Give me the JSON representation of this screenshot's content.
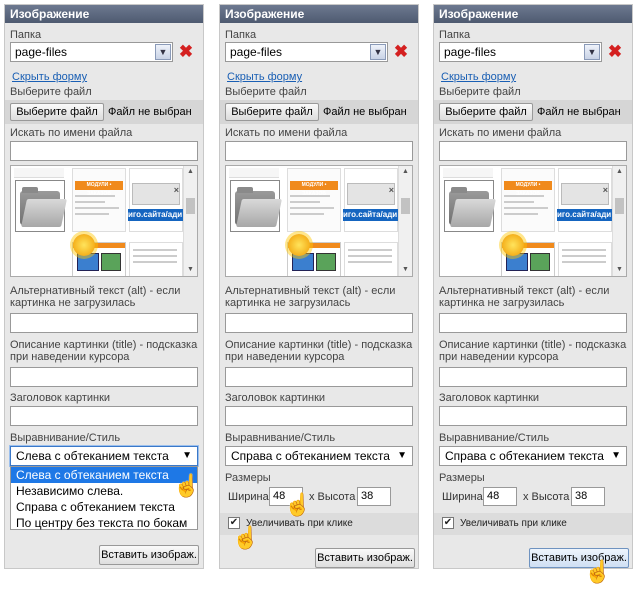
{
  "panels": [
    {
      "title": "Изображение",
      "folder_label": "Папка",
      "folder_value": "page-files",
      "hide_form_link": "Скрыть форму",
      "choose_file_label": "Выберите файл",
      "choose_file_button": "Выберите файл",
      "no_file_text": "Файл не выбран",
      "search_label": "Искать по имени файла",
      "alt_label": "Альтернативный текст (alt) - если картинка не загрузилась",
      "title_label": "Описание картинки (title) - подсказка при наведении курсора",
      "heading_label": "Заголовок картинки",
      "align_label": "Выравнивание/Стиль",
      "align_value": "Слева с обтеканием текста",
      "insert_button": "Вставить изображ."
    },
    {
      "title": "Изображение",
      "folder_label": "Папка",
      "folder_value": "page-files",
      "hide_form_link": "Скрыть форму",
      "choose_file_label": "Выберите файл",
      "choose_file_button": "Выберите файл",
      "no_file_text": "Файл не выбран",
      "search_label": "Искать по имени файла",
      "alt_label": "Альтернативный текст (alt) - если картинка не загрузилась",
      "title_label": "Описание картинки (title) - подсказка при наведении курсора",
      "heading_label": "Заголовок картинки",
      "align_label": "Выравнивание/Стиль",
      "align_value": "Справа с обтеканием текста",
      "sizes_label": "Размеры",
      "width_label": "Ширина",
      "width_value": "48",
      "height_label": "x Высота",
      "height_value": "38",
      "enlarge_label": "Увеличивать при клике",
      "insert_button": "Вставить изображ."
    },
    {
      "title": "Изображение",
      "folder_label": "Папка",
      "folder_value": "page-files",
      "hide_form_link": "Скрыть форму",
      "choose_file_label": "Выберите файл",
      "choose_file_button": "Выберите файл",
      "no_file_text": "Файл не выбран",
      "search_label": "Искать по имени файла",
      "alt_label": "Альтернативный текст (alt) - если картинка не загрузилась",
      "title_label": "Описание картинки (title) - подсказка при наведении курсора",
      "heading_label": "Заголовок картинки",
      "align_label": "Выравнивание/Стиль",
      "align_value": "Справа с обтеканием текста",
      "sizes_label": "Размеры",
      "width_label": "Ширина",
      "width_value": "48",
      "height_label": "x Высота",
      "height_value": "38",
      "enlarge_label": "Увеличивать при клике",
      "insert_button": "Вставить изображ."
    }
  ],
  "dropdown_options": [
    "Слева с обтеканием текста",
    "Независимо слева.",
    "Справа с обтеканием текста",
    "По центру без текста по бокам"
  ],
  "thumb_texts": {
    "orange_bar": "МОДУЛИ • ЗАКАЗОВ",
    "site": "иго.сайта/ади"
  },
  "icons": {
    "dropdown": "chevron-down-icon",
    "delete": "red-x-icon",
    "cursor": "hand-pointer-icon",
    "folder": "folder-icon"
  },
  "colors": {
    "title_bar": "#5a6680",
    "link": "#1a5fb4",
    "selected_option": "#1e78e6",
    "delete": "#d42020"
  }
}
